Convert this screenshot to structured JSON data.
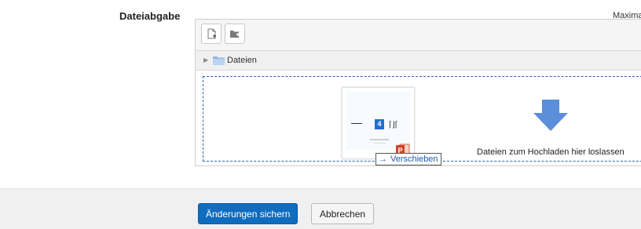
{
  "field": {
    "label": "Dateiabgabe",
    "max_label": "Maxima"
  },
  "toolbar": {
    "add_file_icon": "add-file-icon",
    "create_folder_icon": "create-folder-icon"
  },
  "path": {
    "label": "Dateien",
    "folder_icon": "folder-icon",
    "expand_icon": "expand-triangle-icon"
  },
  "dragged_file": {
    "slide_number": "4",
    "file_type_icon": "powerpoint-icon"
  },
  "dropzone": {
    "text": "Dateien zum Hochladen hier loslassen",
    "arrow_icon": "down-arrow-icon"
  },
  "drag_tooltip": {
    "icon": "arrow-right-icon",
    "label": "Verschieben"
  },
  "buttons": {
    "save": "Änderungen sichern",
    "cancel": "Abbrechen"
  },
  "colors": {
    "primary": "#0f6cbf",
    "dropzone_border": "#2a64b8",
    "arrow": "#5b8fd9"
  }
}
